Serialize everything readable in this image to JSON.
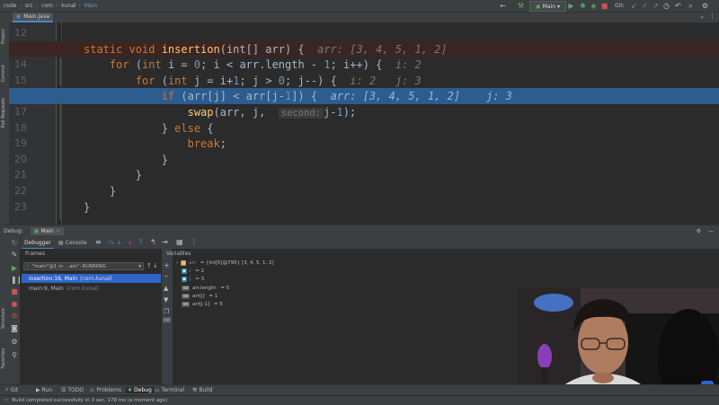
{
  "nav": {
    "crumbs": [
      "code",
      "src",
      "com",
      "kunal",
      "Main"
    ],
    "run_config": "Main",
    "git_label": "Git:"
  },
  "editor": {
    "file_tab": "Main.java",
    "lines": [
      {
        "num": "12"
      },
      {
        "num": "13",
        "code": [
          [
            "kw",
            "static "
          ],
          [
            "kw",
            "void "
          ],
          [
            "fn",
            "insertion"
          ],
          [
            "",
            "(int[] arr) {  "
          ],
          [
            "inl",
            "arr: [3, 4, 5, 1, 2]"
          ]
        ]
      },
      {
        "num": "14",
        "code": [
          [
            "",
            "    "
          ],
          [
            "kw",
            "for "
          ],
          [
            "",
            "("
          ],
          [
            "kw",
            "int "
          ],
          [
            "",
            "i = "
          ],
          [
            "num",
            "0"
          ],
          [
            "",
            "; i < arr.length - "
          ],
          [
            "num",
            "1"
          ],
          [
            "",
            "; i++) {  "
          ],
          [
            "inl",
            "i: 2"
          ]
        ]
      },
      {
        "num": "15",
        "code": [
          [
            "",
            "        "
          ],
          [
            "kw",
            "for "
          ],
          [
            "",
            "("
          ],
          [
            "kw",
            "int "
          ],
          [
            "",
            "j = i+"
          ],
          [
            "num",
            "1"
          ],
          [
            "",
            "; j > "
          ],
          [
            "num",
            "0"
          ],
          [
            "",
            "; j--) {  "
          ],
          [
            "inl",
            "i: 2   j: 3"
          ]
        ]
      },
      {
        "num": "16",
        "code": [
          [
            "",
            "            "
          ],
          [
            "kw",
            "if "
          ],
          [
            "",
            "(arr[j] < arr[j-"
          ],
          [
            "num",
            "1"
          ],
          [
            "",
            "]) {  "
          ],
          [
            "inl",
            "arr: [3, 4, 5, 1, 2]    j: 3"
          ]
        ]
      },
      {
        "num": "17",
        "code": [
          [
            "",
            "                "
          ],
          [
            "fn",
            "swap"
          ],
          [
            "",
            "(arr, j,  "
          ],
          [
            "param",
            "second:"
          ],
          [
            "",
            "j-"
          ],
          [
            "num",
            "1"
          ],
          [
            "",
            ");"
          ]
        ]
      },
      {
        "num": "18",
        "code": [
          [
            "",
            "            } "
          ],
          [
            "kw",
            "else "
          ],
          [
            "",
            "{"
          ]
        ]
      },
      {
        "num": "19",
        "code": [
          [
            "",
            "                "
          ],
          [
            "kw",
            "break"
          ],
          [
            "",
            ";"
          ]
        ]
      },
      {
        "num": "20",
        "code": [
          [
            "",
            "            }"
          ]
        ]
      },
      {
        "num": "21",
        "code": [
          [
            "",
            "        }"
          ]
        ]
      },
      {
        "num": "22",
        "code": [
          [
            "",
            "    }"
          ]
        ]
      },
      {
        "num": "23",
        "code": [
          [
            "",
            "}"
          ]
        ]
      }
    ]
  },
  "left_strip": [
    "Project",
    "Commit",
    "Pull Requests"
  ],
  "left_strip_lower": [
    "Structure",
    "Favorites"
  ],
  "debug": {
    "label": "Debug:",
    "session_tab": "Main",
    "debugger_tab": "Debugger",
    "console_tab": "Console",
    "frames_title": "Frames",
    "thread": "\"main\"@1 in …ain\": RUNNING",
    "frames": [
      {
        "name": "insertion:16, Main",
        "pkg": "(com.kunal)"
      },
      {
        "name": "main:9, Main",
        "pkg": "(com.kunal)"
      }
    ],
    "variables_title": "Variables",
    "variables": [
      {
        "name": "arr",
        "val": " = {int[5]@795} [3, 4, 5, 1, 2]",
        "icon": "array",
        "expand": true
      },
      {
        "name": "i",
        "val": " = 2",
        "icon": "p"
      },
      {
        "name": "j",
        "val": " = 3",
        "icon": "p"
      },
      {
        "name": "arr.length",
        "val": " = 5",
        "icon": "oo"
      },
      {
        "name": "arr[j]",
        "val": " = 1",
        "icon": "oo"
      },
      {
        "name": "arr[j-1]",
        "val": " = 5",
        "icon": "oo"
      }
    ]
  },
  "bottom_tabs": [
    "Git",
    "Run",
    "TODO",
    "Problems",
    "Debug",
    "Terminal",
    "Build"
  ],
  "status": "Build completed successfully in 3 sec, 178 ms (a moment ago)"
}
